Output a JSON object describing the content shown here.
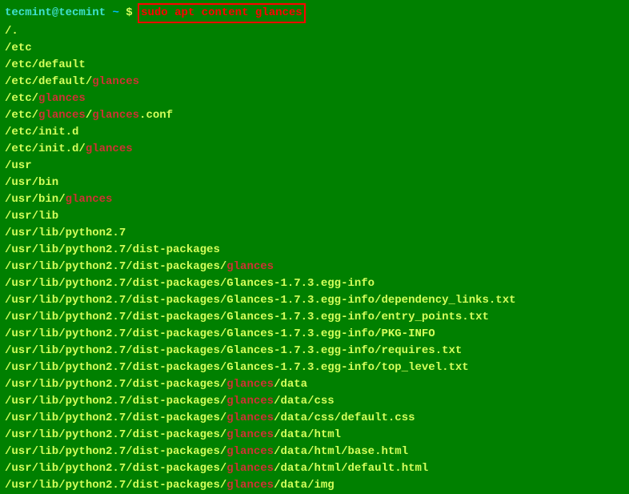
{
  "prompt": {
    "user_host": "tecmint@tecmint",
    "tilde": "~",
    "dollar": "$",
    "command": "sudo apt content glances"
  },
  "output_lines": [
    [
      {
        "t": "/.",
        "h": false
      }
    ],
    [
      {
        "t": "/etc",
        "h": false
      }
    ],
    [
      {
        "t": "/etc/default",
        "h": false
      }
    ],
    [
      {
        "t": "/etc/default/",
        "h": false
      },
      {
        "t": "glances",
        "h": true
      }
    ],
    [
      {
        "t": "/etc/",
        "h": false
      },
      {
        "t": "glances",
        "h": true
      }
    ],
    [
      {
        "t": "/etc/",
        "h": false
      },
      {
        "t": "glances",
        "h": true
      },
      {
        "t": "/",
        "h": false
      },
      {
        "t": "glances",
        "h": true
      },
      {
        "t": ".conf",
        "h": false
      }
    ],
    [
      {
        "t": "/etc/init.d",
        "h": false
      }
    ],
    [
      {
        "t": "/etc/init.d/",
        "h": false
      },
      {
        "t": "glances",
        "h": true
      }
    ],
    [
      {
        "t": "/usr",
        "h": false
      }
    ],
    [
      {
        "t": "/usr/bin",
        "h": false
      }
    ],
    [
      {
        "t": "/usr/bin/",
        "h": false
      },
      {
        "t": "glances",
        "h": true
      }
    ],
    [
      {
        "t": "/usr/lib",
        "h": false
      }
    ],
    [
      {
        "t": "/usr/lib/python2.7",
        "h": false
      }
    ],
    [
      {
        "t": "/usr/lib/python2.7/dist-packages",
        "h": false
      }
    ],
    [
      {
        "t": "/usr/lib/python2.7/dist-packages/",
        "h": false
      },
      {
        "t": "glances",
        "h": true
      }
    ],
    [
      {
        "t": "/usr/lib/python2.7/dist-packages/Glances-1.7.3.egg-info",
        "h": false
      }
    ],
    [
      {
        "t": "/usr/lib/python2.7/dist-packages/Glances-1.7.3.egg-info/dependency_links.txt",
        "h": false
      }
    ],
    [
      {
        "t": "/usr/lib/python2.7/dist-packages/Glances-1.7.3.egg-info/entry_points.txt",
        "h": false
      }
    ],
    [
      {
        "t": "/usr/lib/python2.7/dist-packages/Glances-1.7.3.egg-info/PKG-INFO",
        "h": false
      }
    ],
    [
      {
        "t": "/usr/lib/python2.7/dist-packages/Glances-1.7.3.egg-info/requires.txt",
        "h": false
      }
    ],
    [
      {
        "t": "/usr/lib/python2.7/dist-packages/Glances-1.7.3.egg-info/top_level.txt",
        "h": false
      }
    ],
    [
      {
        "t": "/usr/lib/python2.7/dist-packages/",
        "h": false
      },
      {
        "t": "glances",
        "h": true
      },
      {
        "t": "/data",
        "h": false
      }
    ],
    [
      {
        "t": "/usr/lib/python2.7/dist-packages/",
        "h": false
      },
      {
        "t": "glances",
        "h": true
      },
      {
        "t": "/data/css",
        "h": false
      }
    ],
    [
      {
        "t": "/usr/lib/python2.7/dist-packages/",
        "h": false
      },
      {
        "t": "glances",
        "h": true
      },
      {
        "t": "/data/css/default.css",
        "h": false
      }
    ],
    [
      {
        "t": "/usr/lib/python2.7/dist-packages/",
        "h": false
      },
      {
        "t": "glances",
        "h": true
      },
      {
        "t": "/data/html",
        "h": false
      }
    ],
    [
      {
        "t": "/usr/lib/python2.7/dist-packages/",
        "h": false
      },
      {
        "t": "glances",
        "h": true
      },
      {
        "t": "/data/html/base.html",
        "h": false
      }
    ],
    [
      {
        "t": "/usr/lib/python2.7/dist-packages/",
        "h": false
      },
      {
        "t": "glances",
        "h": true
      },
      {
        "t": "/data/html/default.html",
        "h": false
      }
    ],
    [
      {
        "t": "/usr/lib/python2.7/dist-packages/",
        "h": false
      },
      {
        "t": "glances",
        "h": true
      },
      {
        "t": "/data/img",
        "h": false
      }
    ]
  ]
}
